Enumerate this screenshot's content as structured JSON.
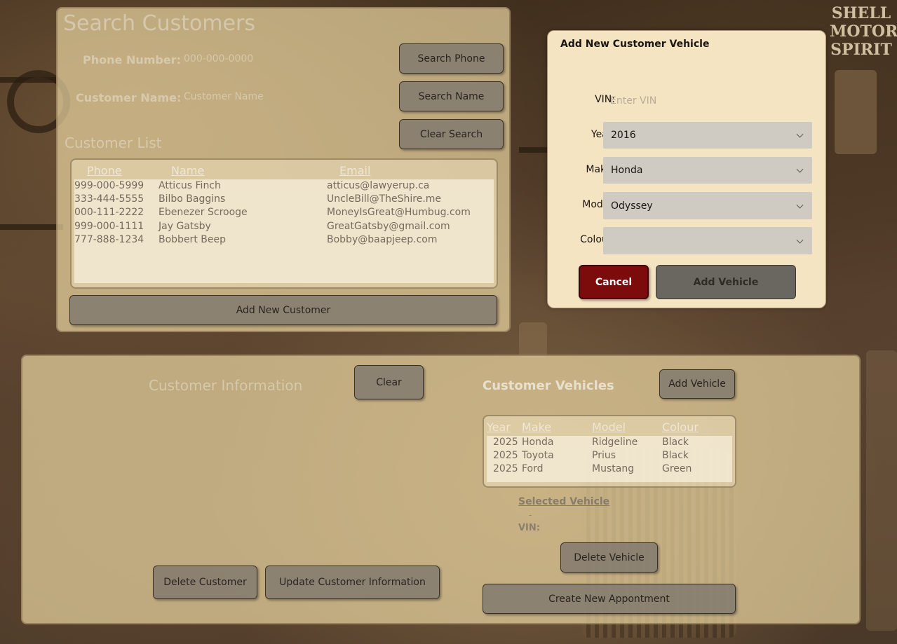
{
  "search": {
    "title": "Search Customers",
    "phone_label": "Phone Number:",
    "phone_placeholder": "000-000-0000",
    "name_label": "Customer Name:",
    "name_placeholder": "Customer Name",
    "search_phone_label": "Search Phone",
    "search_name_label": "Search Name",
    "clear_search_label": "Clear Search",
    "list_title": "Customer List",
    "columns": [
      "Phone",
      "Name",
      "Email"
    ],
    "customers": [
      {
        "phone": "999-000-5999",
        "name": "Atticus Finch",
        "email": "atticus@lawyerup.ca"
      },
      {
        "phone": "333-444-5555",
        "name": "Bilbo Baggins",
        "email": "UncleBill@TheShire.me"
      },
      {
        "phone": "000-111-2222",
        "name": "Ebenezer Scrooge",
        "email": "MoneyIsGreat@Humbug.com"
      },
      {
        "phone": "999-000-1111",
        "name": "Jay Gatsby",
        "email": "GreatGatsby@gmail.com"
      },
      {
        "phone": "777-888-1234",
        "name": "Bobbert Beep",
        "email": "Bobby@baapjeep.com"
      }
    ],
    "add_new_customer_label": "Add New Customer"
  },
  "info": {
    "title": "Customer Information",
    "clear_label": "Clear",
    "delete_customer_label": "Delete Customer",
    "update_customer_label": "Update Customer Information"
  },
  "vehicles": {
    "title": "Customer Vehicles",
    "add_vehicle_label": "Add Vehicle",
    "columns": [
      "Year",
      "Make",
      "Model",
      "Colour"
    ],
    "rows": [
      {
        "year": "2025",
        "make": "Honda",
        "model": "Ridgeline",
        "colour": "Black"
      },
      {
        "year": "2025",
        "make": "Toyota",
        "model": "Prius",
        "colour": "Black"
      },
      {
        "year": "2025",
        "make": "Ford",
        "model": "Mustang",
        "colour": "Green"
      }
    ],
    "selected_label": "Selected Vehicle",
    "selected_dash": "-",
    "vin_label": "VIN:",
    "delete_vehicle_label": "Delete Vehicle",
    "create_appointment_label": "Create New Appontment"
  },
  "dialog": {
    "title": "Add New Customer Vehicle",
    "vin_label": "VIN:",
    "vin_placeholder": "Enter VIN",
    "year_label": "Year:",
    "year_value": "2016",
    "make_label": "Make:",
    "make_value": "Honda",
    "model_label": "Model:",
    "model_value": "Odyssey",
    "colour_label": "Colour:",
    "colour_value": "",
    "cancel_label": "Cancel",
    "add_label": "Add Vehicle",
    "colors": {
      "cancel": "#7c0c0c",
      "background": "#f5e4c2"
    }
  },
  "background": {
    "sign_text": "SHELL MOTOR SPIRIT"
  }
}
